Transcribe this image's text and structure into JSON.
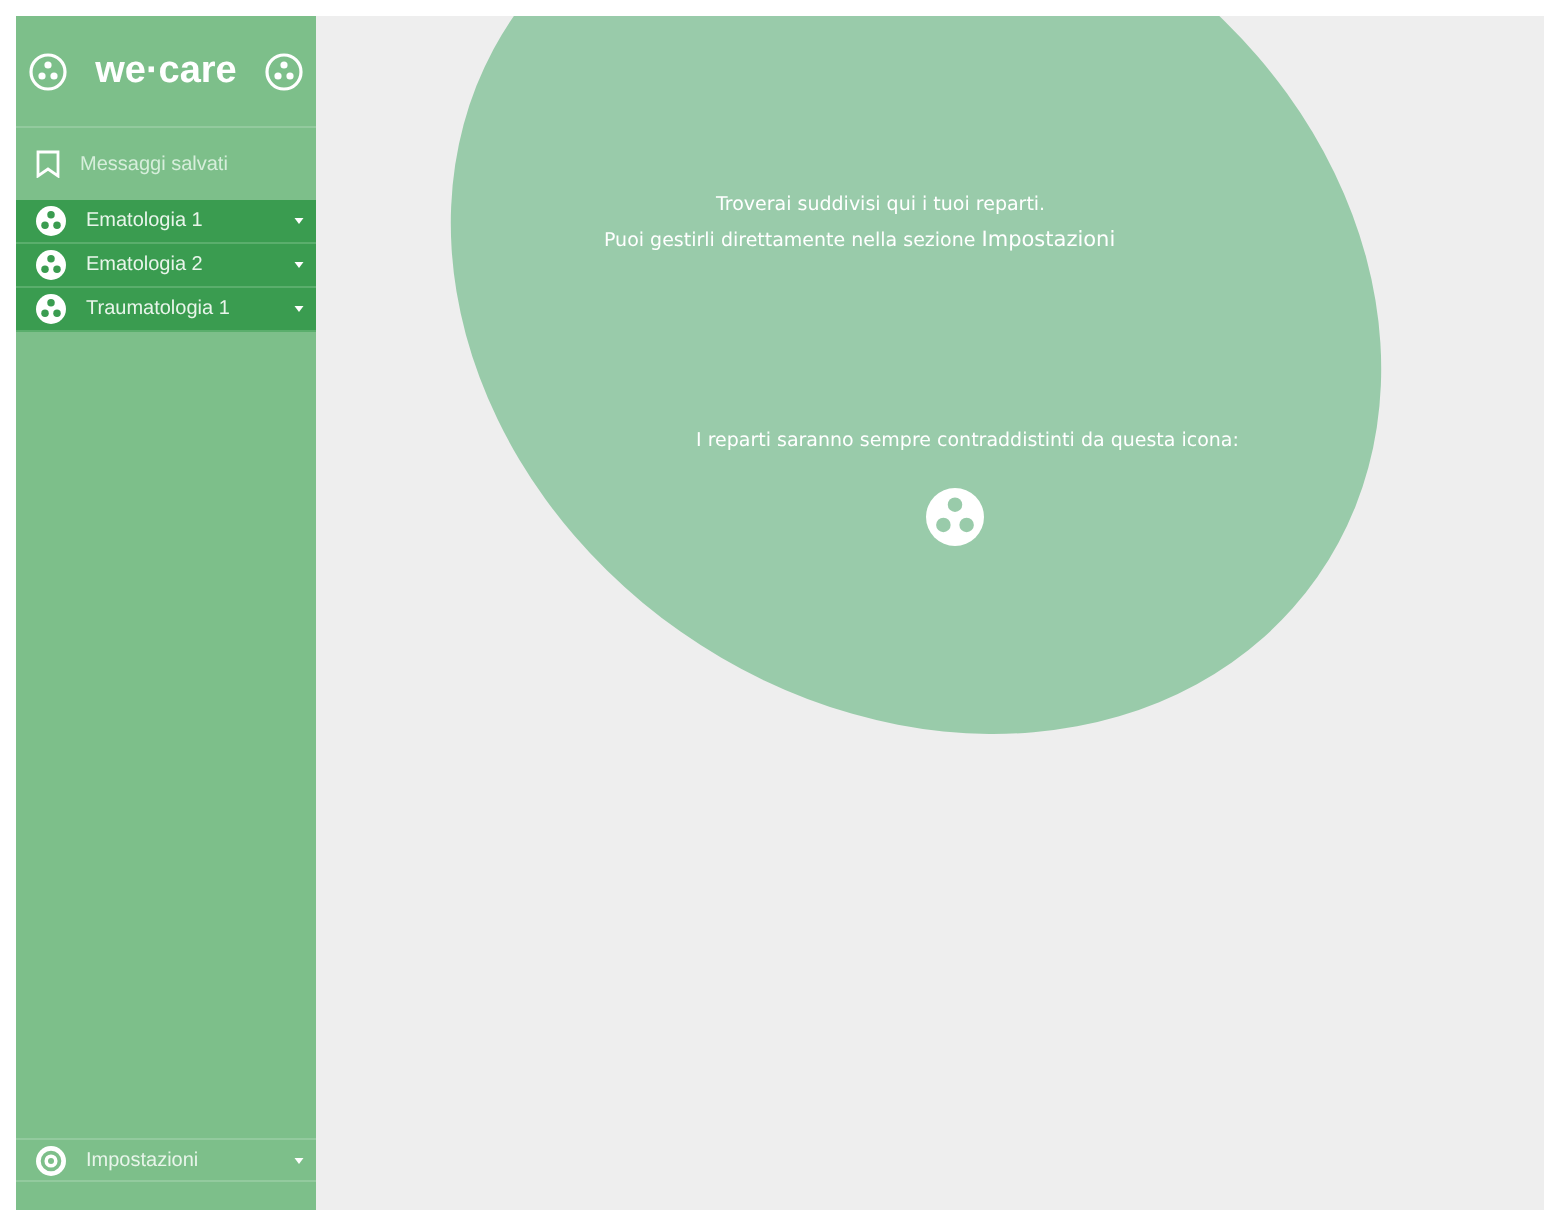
{
  "sidebar": {
    "logo": "we·care",
    "saved": {
      "label": "Messaggi salvati"
    },
    "departments": [
      {
        "label": "Ematologia 1"
      },
      {
        "label": "Ematologia 2"
      },
      {
        "label": "Traumatologia 1"
      }
    ],
    "settings": {
      "label": "Impostazioni"
    }
  },
  "main": {
    "intro": "Troverai suddivisi qui i tuoi reparti.",
    "manage": "Puoi gestirli direttamente nella sezione",
    "manage_link": "Impostazioni",
    "icon_note": "I reparti saranno sempre contraddistinti da questa icona:"
  }
}
